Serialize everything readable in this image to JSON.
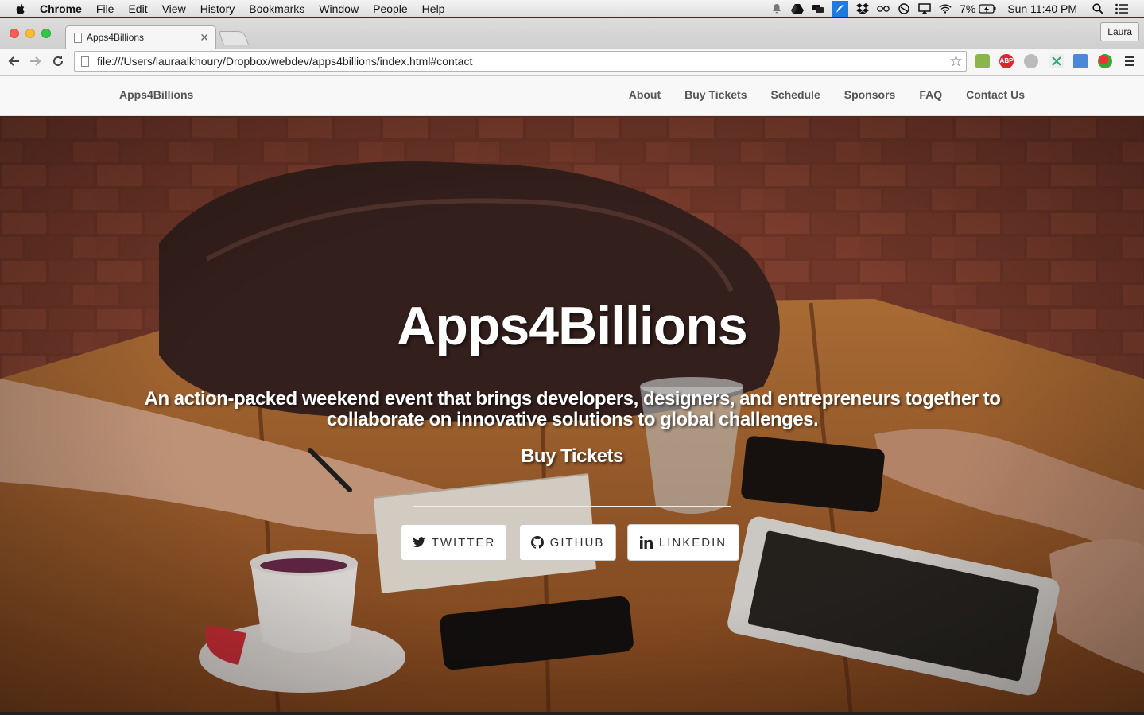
{
  "menubar": {
    "app": "Chrome",
    "items": [
      "File",
      "Edit",
      "View",
      "History",
      "Bookmarks",
      "Window",
      "People",
      "Help"
    ],
    "battery": "7%",
    "clock": "Sun 11:40 PM"
  },
  "browser": {
    "tab_title": "Apps4Billions",
    "profile_name": "Laura",
    "url": "file:///Users/lauraalkhoury/Dropbox/webdev/apps4billions/index.html#contact"
  },
  "site": {
    "brand": "Apps4Billions",
    "nav": [
      "About",
      "Buy Tickets",
      "Schedule",
      "Sponsors",
      "FAQ",
      "Contact Us"
    ]
  },
  "hero": {
    "title": "Apps4Billions",
    "subtitle": "An action-packed weekend event that brings developers, designers, and entrepreneurs together to collaborate on innovative solutions to global challenges.",
    "cta": "Buy Tickets",
    "social": [
      {
        "label": "TWITTER",
        "icon": "twitter-icon"
      },
      {
        "label": "GITHUB",
        "icon": "github-icon"
      },
      {
        "label": "LINKEDIN",
        "icon": "linkedin-icon"
      }
    ]
  }
}
